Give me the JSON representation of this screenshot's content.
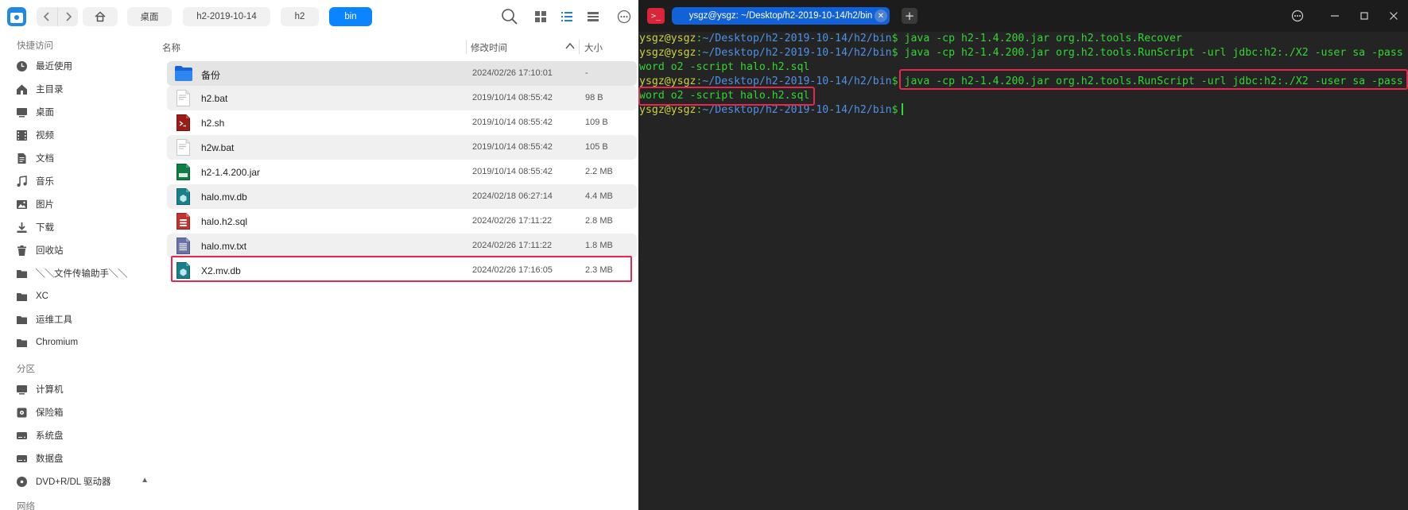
{
  "file_manager": {
    "breadcrumbs": [
      "桌面",
      "h2-2019-10-14",
      "h2",
      "bin"
    ],
    "sidebar": {
      "quick_access_title": "快捷访问",
      "quick_items": [
        {
          "label": "最近使用",
          "icon": "clock-icon"
        },
        {
          "label": "主目录",
          "icon": "home-icon"
        },
        {
          "label": "桌面",
          "icon": "desktop-icon"
        },
        {
          "label": "视频",
          "icon": "video-icon"
        },
        {
          "label": "文档",
          "icon": "document-icon"
        },
        {
          "label": "音乐",
          "icon": "music-icon"
        },
        {
          "label": "图片",
          "icon": "picture-icon"
        },
        {
          "label": "下载",
          "icon": "download-icon"
        },
        {
          "label": "回收站",
          "icon": "trash-icon"
        },
        {
          "label": "╲╲文件传输助手╲╲",
          "icon": "folder-icon"
        },
        {
          "label": "XC",
          "icon": "folder-icon"
        },
        {
          "label": "运维工具",
          "icon": "folder-icon"
        },
        {
          "label": "Chromium",
          "icon": "folder-icon"
        }
      ],
      "partition_title": "分区",
      "partition_items": [
        {
          "label": "计算机",
          "icon": "computer-icon"
        },
        {
          "label": "保险箱",
          "icon": "vault-icon"
        },
        {
          "label": "系统盘",
          "icon": "disk-icon"
        },
        {
          "label": "数据盘",
          "icon": "disk-icon"
        },
        {
          "label": "DVD+R/DL 驱动器",
          "icon": "dvd-drive-icon"
        }
      ],
      "network_title": "网络"
    },
    "columns": {
      "name": "名称",
      "modified": "修改时间",
      "size": "大小"
    },
    "files": [
      {
        "name": "备份",
        "modified": "2024/02/26 17:10:01",
        "size": "-",
        "type": "folder"
      },
      {
        "name": "h2.bat",
        "modified": "2019/10/14 08:55:42",
        "size": "98 B",
        "type": "text"
      },
      {
        "name": "h2.sh",
        "modified": "2019/10/14 08:55:42",
        "size": "109 B",
        "type": "script"
      },
      {
        "name": "h2w.bat",
        "modified": "2019/10/14 08:55:42",
        "size": "105 B",
        "type": "text"
      },
      {
        "name": "h2-1.4.200.jar",
        "modified": "2019/10/14 08:55:42",
        "size": "2.2 MB",
        "type": "jar"
      },
      {
        "name": "halo.mv.db",
        "modified": "2024/02/18 06:27:14",
        "size": "4.4 MB",
        "type": "db"
      },
      {
        "name": "halo.h2.sql",
        "modified": "2024/02/26 17:11:22",
        "size": "2.8 MB",
        "type": "sql"
      },
      {
        "name": "halo.mv.txt",
        "modified": "2024/02/26 17:11:22",
        "size": "1.8 MB",
        "type": "txt"
      },
      {
        "name": "X2.mv.db",
        "modified": "2024/02/26 17:16:05",
        "size": "2.3 MB",
        "type": "db"
      }
    ]
  },
  "terminal": {
    "tab_title": "ysgz@ysgz: ~/Desktop/h2-2019-10-14/h2/bin",
    "lines": [
      {
        "user": "ysgz@ysgz",
        "sep": ":",
        "path": "~/Desktop/h2-2019-10-14/h2/bin",
        "sym": "$",
        "cmd": " java -cp h2-1.4.200.jar org.h2.tools.Recover"
      },
      {
        "user": "ysgz@ysgz",
        "sep": ":",
        "path": "~/Desktop/h2-2019-10-14/h2/bin",
        "sym": "$",
        "cmd": " java -cp h2-1.4.200.jar org.h2.tools.RunScript -url jdbc:h2:./X2 -user sa -pass"
      },
      {
        "text": "word o2 -script halo.h2.sql"
      },
      {
        "user": "ysgz@ysgz",
        "sep": ":",
        "path": "~/Desktop/h2-2019-10-14/h2/bin",
        "sym": "$",
        "cmd": " java -cp h2-1.4.200.jar org.h2.tools.RunScript -url jdbc:h2:./X2 -user sa -pass"
      },
      {
        "text": "word o2 -script halo.h2.sql"
      },
      {
        "user": "ysgz@ysgz",
        "sep": ":",
        "path": "~/Desktop/h2-2019-10-14/h2/bin",
        "sym": "$",
        "cmd": ""
      }
    ]
  },
  "colors": {
    "accent": "#0a84ff",
    "highlight": "#e5284c",
    "terminal_bg": "#242424",
    "terminal_green": "#33d633"
  }
}
